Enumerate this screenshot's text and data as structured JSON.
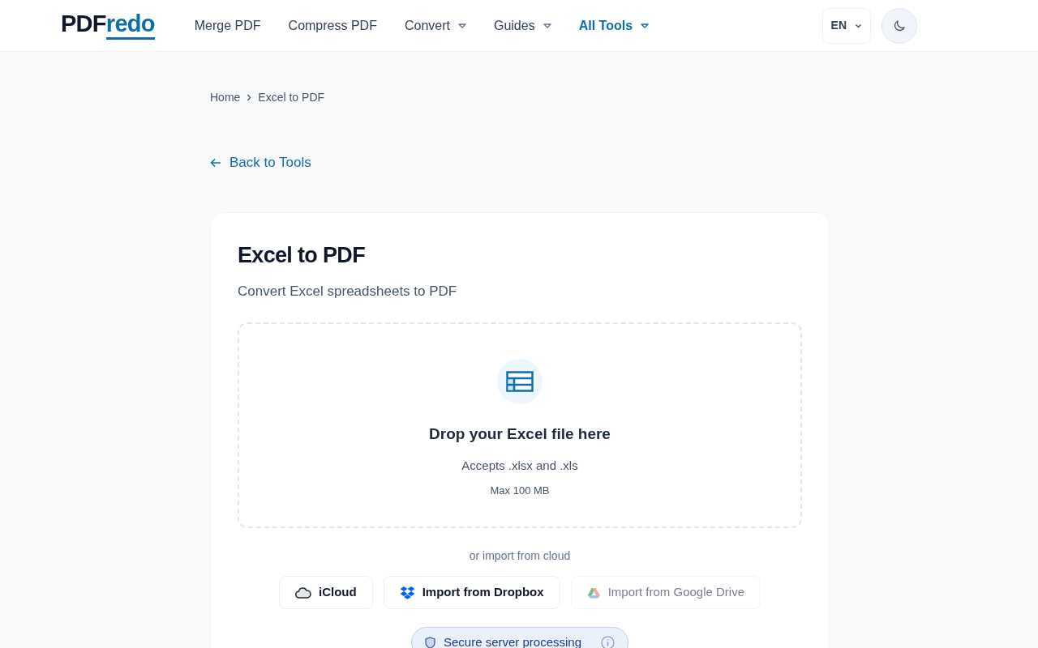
{
  "logo": {
    "part_1": "PDF",
    "part_2": "redo"
  },
  "nav": [
    {
      "label": "Merge PDF",
      "dropdown": false,
      "selected": false
    },
    {
      "label": "Compress PDF",
      "dropdown": false,
      "selected": false
    },
    {
      "label": "Convert",
      "dropdown": true,
      "selected": false
    },
    {
      "label": "Guides",
      "dropdown": true,
      "selected": false
    },
    {
      "label": "All Tools",
      "dropdown": true,
      "selected": true
    }
  ],
  "language": "EN",
  "breadcrumb": [
    "Home",
    "Excel to PDF"
  ],
  "back_link": "Back to Tools",
  "card": {
    "title": "Excel to PDF",
    "subtitle": "Convert Excel spreadsheets to PDF",
    "dropzone": {
      "title": "Drop your Excel file here",
      "accepts": "Accepts .xlsx and .xls",
      "max_size": "Max 100 MB"
    },
    "cloud_label": "or import from cloud",
    "cloud_buttons": [
      {
        "kind": "icloud",
        "label": "iCloud",
        "disabled": false
      },
      {
        "kind": "dropbox",
        "label": "Import from Dropbox",
        "disabled": false
      },
      {
        "kind": "gdrive",
        "label": "Import from Google Drive",
        "disabled": true
      }
    ],
    "security_badge": "Secure server processing"
  }
}
